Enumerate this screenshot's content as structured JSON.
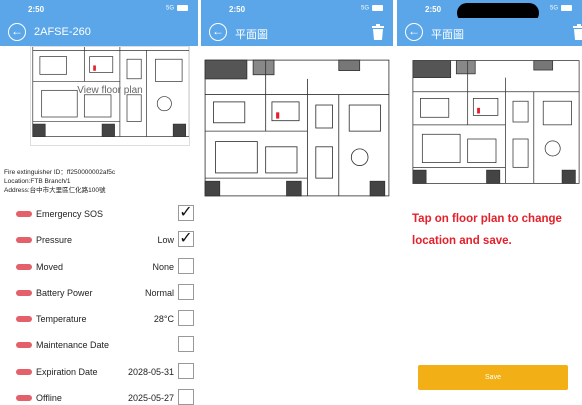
{
  "status": {
    "time": "2:50",
    "network": "5G"
  },
  "screen1": {
    "title": "2AFSE-260",
    "plan_overlay": "View floor plan",
    "info": [
      "Fire extinguisher ID：ff250000002af5c",
      "Location:FTB Branch/1",
      "Address:台中市大里區仁化路100號"
    ],
    "rows": [
      {
        "label": "Emergency SOS",
        "value": "",
        "checked": true
      },
      {
        "label": "Pressure",
        "value": "Low",
        "checked": true
      },
      {
        "label": "Moved",
        "value": "None",
        "checked": false
      },
      {
        "label": "Battery Power",
        "value": "Normal",
        "checked": false
      },
      {
        "label": "Temperature",
        "value": "28°C",
        "checked": false
      },
      {
        "label": "Maintenance Date",
        "value": "",
        "checked": false
      },
      {
        "label": "Expiration Date",
        "value": "2028-05-31",
        "checked": false
      },
      {
        "label": "Offline",
        "value": "2025-05-27",
        "checked": false
      }
    ]
  },
  "screen2": {
    "title": "平面圖"
  },
  "screen3": {
    "title": "平面圖",
    "tip": "Tap on floor plan to change location and save.",
    "save_label": "Save"
  },
  "colors": {
    "header": "#5aa6e8",
    "status_dot": "#e4606a",
    "tip": "#e4202a",
    "save": "#f2b016"
  },
  "icons": [
    "back-arrow-icon",
    "trash-icon",
    "battery-icon",
    "checkmark-icon"
  ]
}
